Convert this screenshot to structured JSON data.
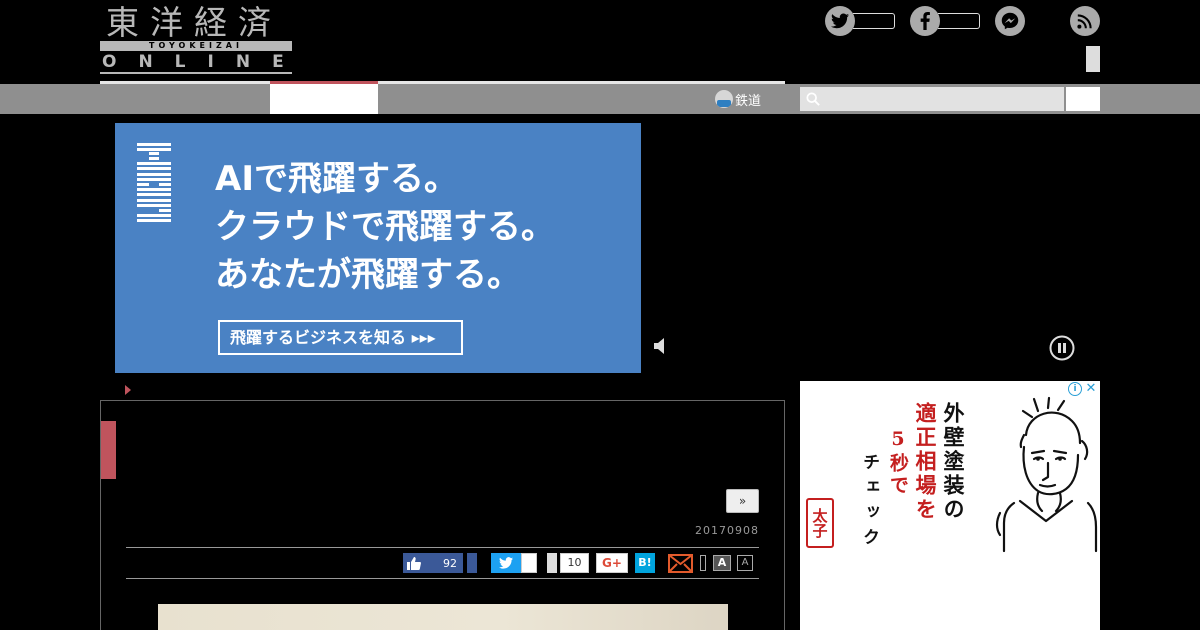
{
  "header": {
    "logo_kanji": "東洋経済",
    "logo_band": "TOYOKEIZAI",
    "logo_sub": "ONLINE"
  },
  "nav": {
    "rail_label": "鉄道",
    "search": {
      "placeholder": ""
    }
  },
  "ad_banner": {
    "brand": "IBM",
    "lines": [
      "AIで飛躍する。",
      "クラウドで飛躍する。",
      "あなたが飛躍する。"
    ],
    "cta": "飛躍するビジネスを知る ▸▸▸",
    "accent": "#4a82c4"
  },
  "article": {
    "more_label": "»",
    "date": "20170908",
    "share": {
      "facebook_count": "92",
      "gplus_count": "10",
      "gplus_label": "G+",
      "hatena_label": "B!",
      "font_large_label": "A",
      "font_small_label": "A"
    },
    "accent": "#c0545d"
  },
  "side_ad": {
    "info_label": "i",
    "close_label": "✕",
    "col1": "外壁塗装の",
    "col2": "適正相場を",
    "col3": "5秒で",
    "col4": "チェック",
    "seal": "太子"
  },
  "icons": [
    "twitter-icon",
    "facebook-icon",
    "messenger-icon",
    "rss-icon",
    "search-icon",
    "mute-icon",
    "pause-icon",
    "mail-icon"
  ]
}
